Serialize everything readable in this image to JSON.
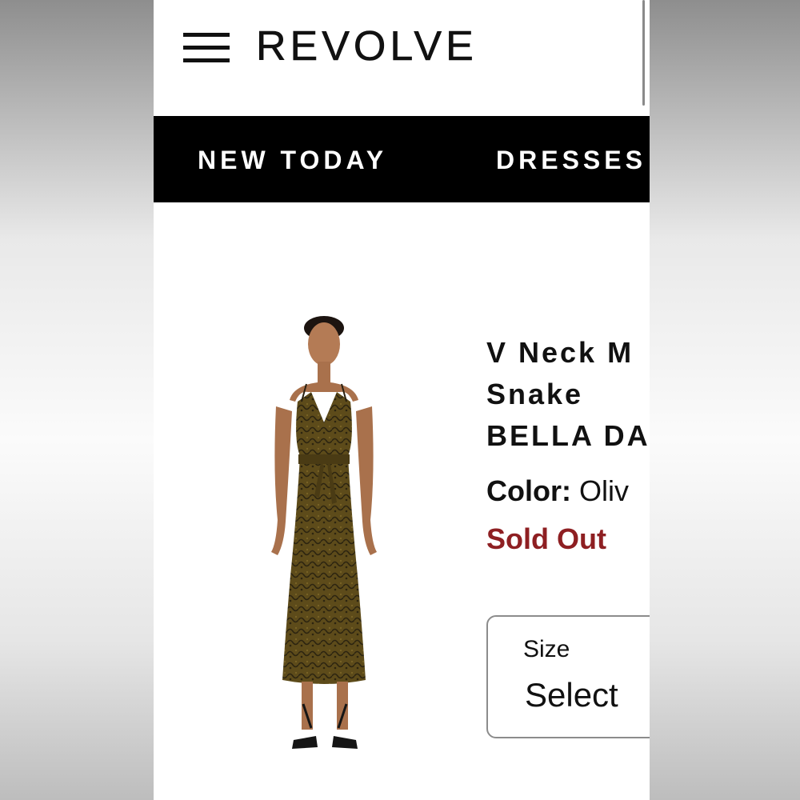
{
  "header": {
    "logo": "REVOLVE",
    "menu_icon": "hamburger-menu-icon"
  },
  "nav": {
    "items": [
      {
        "label": "NEW TODAY"
      },
      {
        "label": "DRESSES"
      }
    ]
  },
  "product": {
    "title_lines": [
      "V Neck M",
      "Snake",
      "BELLA DAH"
    ],
    "color_label": "Color:",
    "color_value": "Oliv",
    "status": "Sold Out",
    "image_alt": "model wearing olive snake print dress"
  },
  "size_select": {
    "label": "Size",
    "value": "Select"
  },
  "colors": {
    "nav_bg": "#000000",
    "sold_out": "#8e1f22",
    "dress": "#5b4a1b"
  }
}
